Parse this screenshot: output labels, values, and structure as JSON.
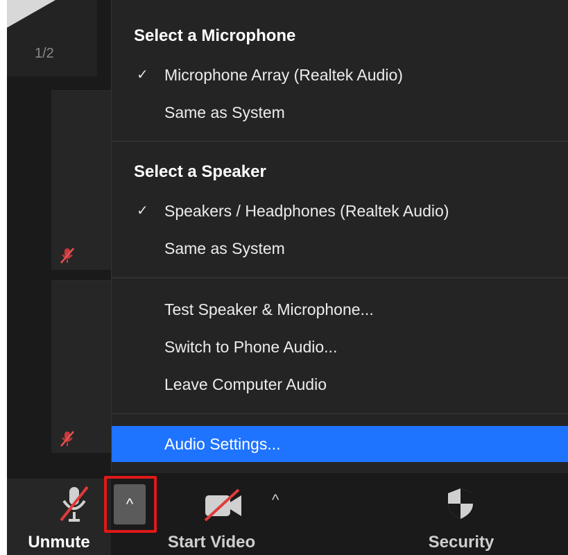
{
  "gallery": {
    "page_indicator": "1/2"
  },
  "menu": {
    "microphone_section": {
      "title": "Select a Microphone",
      "items": [
        {
          "label": "Microphone Array (Realtek Audio)",
          "checked": true
        },
        {
          "label": "Same as System",
          "checked": false
        }
      ]
    },
    "speaker_section": {
      "title": "Select a Speaker",
      "items": [
        {
          "label": "Speakers / Headphones (Realtek Audio)",
          "checked": true
        },
        {
          "label": "Same as System",
          "checked": false
        }
      ]
    },
    "actions": [
      {
        "label": "Test Speaker & Microphone..."
      },
      {
        "label": "Switch to Phone Audio..."
      },
      {
        "label": "Leave Computer Audio"
      }
    ],
    "settings": {
      "label": "Audio Settings..."
    },
    "check_glyph": "✓"
  },
  "toolbar": {
    "unmute_label": "Unmute",
    "start_video_label": "Start Video",
    "security_label": "Security",
    "caret_glyph": "^"
  },
  "colors": {
    "highlight": "#1e73ff",
    "focus_box": "#e01818",
    "muted_red": "#e03a3a"
  }
}
